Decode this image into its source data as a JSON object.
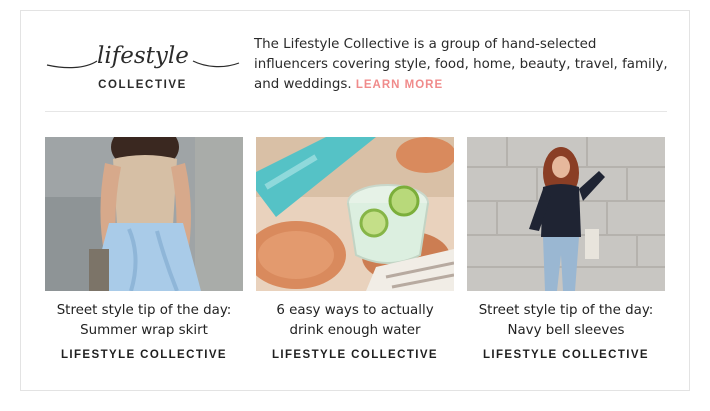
{
  "logo": {
    "script": "lifestyle",
    "sub": "COLLECTIVE"
  },
  "intro": {
    "text": "The Lifestyle Collective is a group of hand-selected influencers covering style, food, home, beauty, travel, family, and weddings. ",
    "learn_more": "LEARN MORE"
  },
  "cards": [
    {
      "title": "Street style tip of the day: Summer wrap skirt",
      "source": "LIFESTYLE COLLECTIVE",
      "image": "woman-in-blue-wrap-skirt-photo"
    },
    {
      "title": "6 easy ways to actually drink enough water",
      "source": "LIFESTYLE COLLECTIVE",
      "image": "glass-of-lime-water-photo"
    },
    {
      "title": "Street style tip of the day: Navy bell sleeves",
      "source": "LIFESTYLE COLLECTIVE",
      "image": "woman-in-navy-bell-sleeves-photo"
    }
  ],
  "colors": {
    "accent": "#f08b8b",
    "text": "#222222",
    "border": "#e3e3e3"
  }
}
